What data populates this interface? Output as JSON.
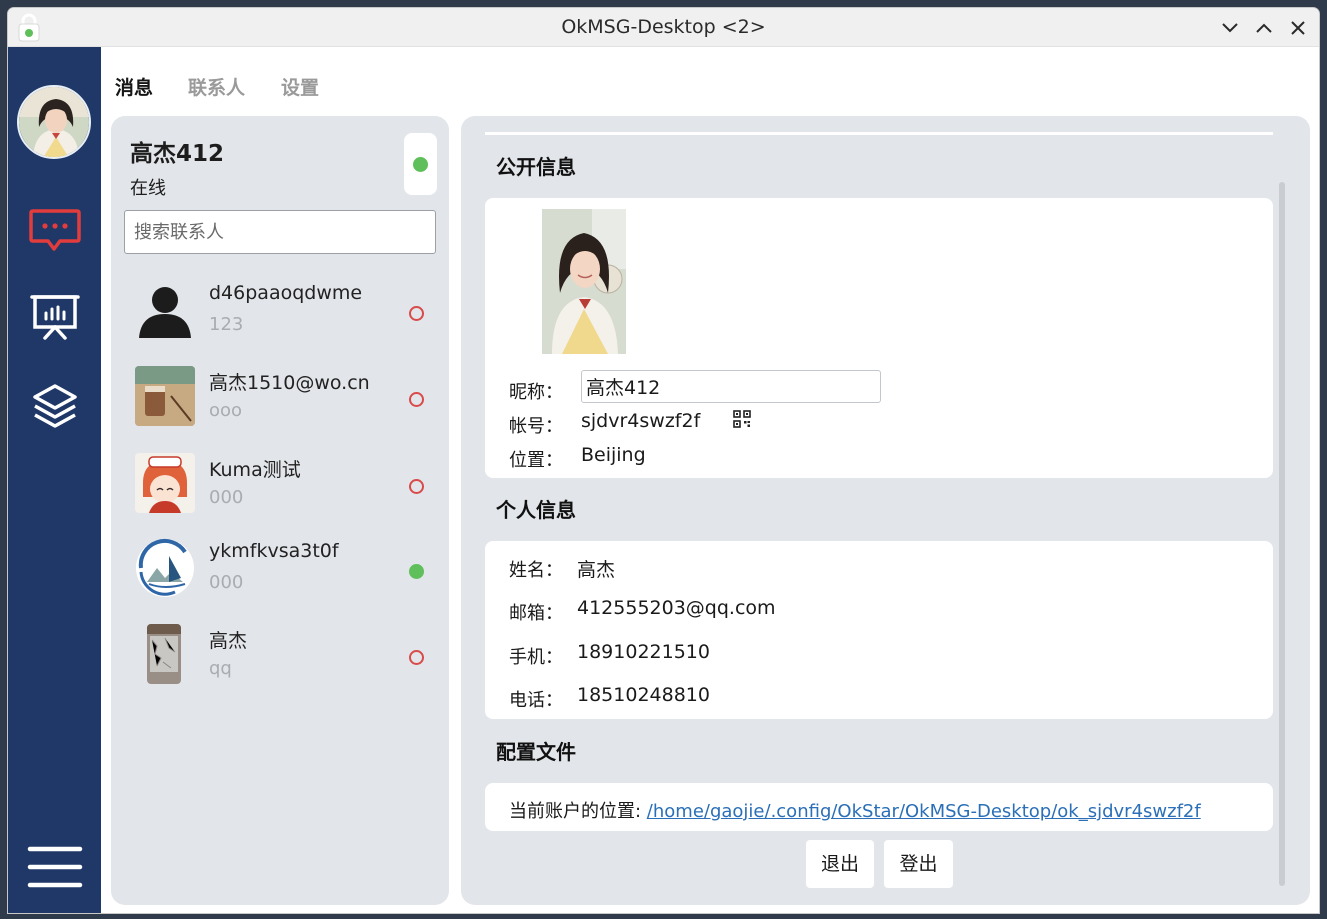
{
  "window": {
    "title": "OkMSG-Desktop <2>"
  },
  "colors": {
    "sidebar": "#1f3868",
    "panel": "#e2e5e9",
    "online": "#5fbf5b",
    "offline": "#d94b4b",
    "message_icon": "#e23c3c",
    "link": "#2a6fb8"
  },
  "sidebar": {
    "items": [
      {
        "name": "avatar"
      },
      {
        "name": "message-icon",
        "active": true
      },
      {
        "name": "presentation-icon"
      },
      {
        "name": "layers-icon"
      },
      {
        "name": "menu-icon"
      }
    ]
  },
  "tabs": [
    {
      "label": "消息",
      "active": true
    },
    {
      "label": "联系人",
      "active": false
    },
    {
      "label": "设置",
      "active": false
    }
  ],
  "me": {
    "name": "高杰412",
    "status": "在线",
    "online": true
  },
  "search": {
    "placeholder": "搜索联系人"
  },
  "contacts": [
    {
      "name": "d46paaoqdwme",
      "message": "123",
      "online": false,
      "avatar": "default-person-icon"
    },
    {
      "name": "高杰1510@wo.cn",
      "message": "ooo",
      "online": false,
      "avatar": "coffee-photo"
    },
    {
      "name": "Kuma测试",
      "message": "000",
      "online": false,
      "avatar": "anime-girl"
    },
    {
      "name": "ykmfkvsa3t0f",
      "message": "000",
      "online": true,
      "avatar": "boat-logo"
    },
    {
      "name": "高杰",
      "message": "qq",
      "online": false,
      "avatar": "stone-photo"
    }
  ],
  "profile": {
    "public_title": "公开信息",
    "nickname_label": "昵称：",
    "nickname": "高杰412",
    "account_label": "帐号：",
    "account": "sjdvr4swzf2f",
    "location_label": "位置：",
    "location": "Beijing",
    "personal_title": "个人信息",
    "realname_label": "姓名：",
    "realname": "高杰",
    "email_label": "邮箱：",
    "email": "412555203@qq.com",
    "mobile_label": "手机：",
    "mobile": "18910221510",
    "phone_label": "电话：",
    "phone": "18510248810",
    "config_title": "配置文件",
    "config_label": "当前账户的位置: ",
    "config_path": "/home/gaojie/.config/OkStar/OkMSG-Desktop/ok_sjdvr4swzf2f",
    "exit_label": "退出",
    "logout_label": "登出"
  }
}
